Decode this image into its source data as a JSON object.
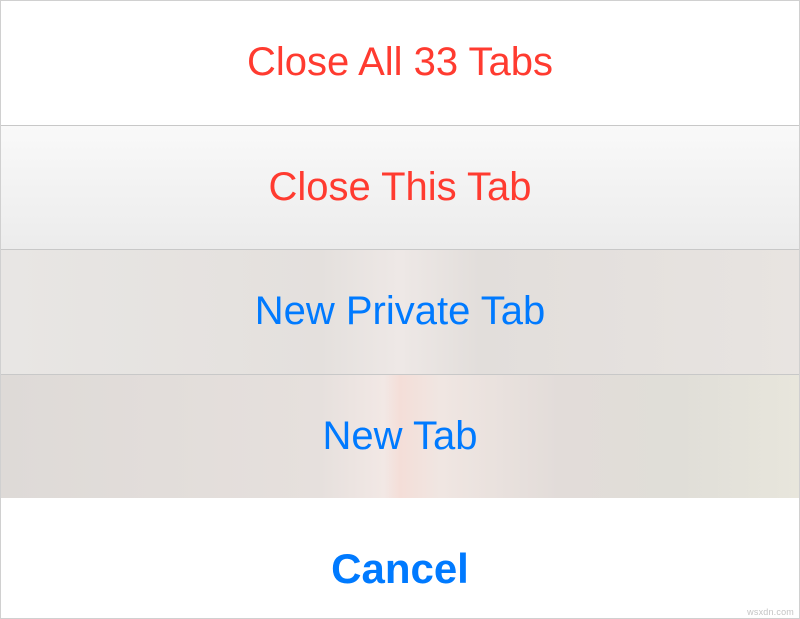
{
  "actionSheet": {
    "options": [
      {
        "label": "Close All 33 Tabs",
        "style": "destructive"
      },
      {
        "label": "Close This Tab",
        "style": "destructive"
      },
      {
        "label": "New Private Tab",
        "style": "normal"
      },
      {
        "label": "New Tab",
        "style": "normal"
      }
    ],
    "cancel": {
      "label": "Cancel"
    }
  },
  "watermark": "wsxdn.com"
}
